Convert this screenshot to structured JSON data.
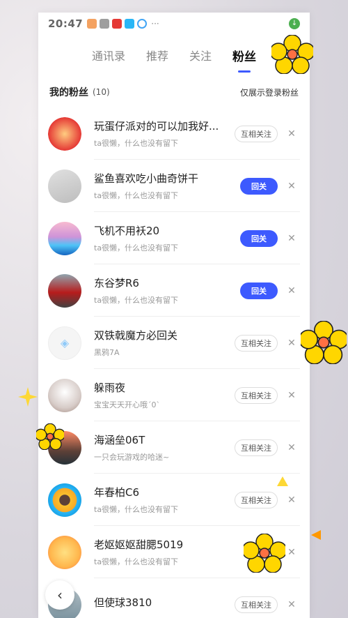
{
  "status_bar": {
    "time": "20:47",
    "dots": "···"
  },
  "tabs": [
    {
      "label": "通讯录",
      "active": false
    },
    {
      "label": "推荐",
      "active": false
    },
    {
      "label": "关注",
      "active": false
    },
    {
      "label": "粉丝",
      "active": true
    }
  ],
  "list_header": {
    "title": "我的粉丝",
    "count": "(10)",
    "filter_label": "仅展示登录粉丝"
  },
  "fans": [
    {
      "name": "玩蛋仔派对的可以加我好...",
      "subtitle": "ta很懒，什么也没有留下",
      "button": "互相关注",
      "button_type": "mutual"
    },
    {
      "name": "鲨鱼喜欢吃小曲奇饼干",
      "subtitle": "ta很懒，什么也没有留下",
      "button": "回关",
      "button_type": "follow"
    },
    {
      "name": "飞机不用袄20",
      "subtitle": "ta很懒，什么也没有留下",
      "button": "回关",
      "button_type": "follow"
    },
    {
      "name": "东谷梦R6",
      "subtitle": "ta很懒，什么也没有留下",
      "button": "回关",
      "button_type": "follow"
    },
    {
      "name": "双铁戟魔方必回关",
      "subtitle": "黑鸦7A",
      "button": "互相关注",
      "button_type": "mutual"
    },
    {
      "name": "躲雨夜",
      "subtitle": "宝宝天天开心哦´0`",
      "button": "互相关注",
      "button_type": "mutual"
    },
    {
      "name": "海涵垒06T",
      "subtitle": "一只会玩游戏的哈迷~",
      "button": "互相关注",
      "button_type": "mutual"
    },
    {
      "name": "年春柏C6",
      "subtitle": "ta很懒，什么也没有留下",
      "button": "互相关注",
      "button_type": "mutual"
    },
    {
      "name": "老妪妪妪甜腮5019",
      "subtitle": "ta很懒，什么也没有留下",
      "button": "",
      "button_type": "follow"
    },
    {
      "name": "但使球3810",
      "subtitle": "",
      "button": "互相关注",
      "button_type": "mutual"
    }
  ],
  "colors": {
    "accent": "#3d5afe"
  }
}
